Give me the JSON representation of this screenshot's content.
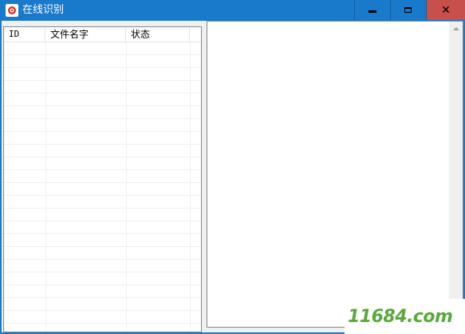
{
  "window": {
    "title": "在线识别",
    "colors": {
      "titlebar": "#1979ca",
      "close": "#c7504a",
      "client": "#f0f0f0"
    },
    "controls": {
      "minimize_icon": "minimize-icon",
      "maximize_icon": "maximize-icon",
      "close_icon": "close-icon",
      "close_glyph": "✕"
    }
  },
  "list": {
    "columns": [
      {
        "label": "ID"
      },
      {
        "label": "文件名字"
      },
      {
        "label": "状态"
      }
    ],
    "rows": []
  },
  "output": {
    "text": ""
  },
  "watermark": {
    "text": "11684.com"
  }
}
